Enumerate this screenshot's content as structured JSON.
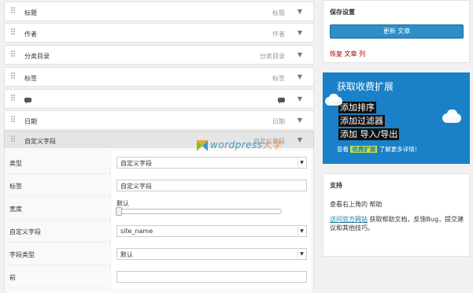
{
  "columns": [
    {
      "name": "标题",
      "desc": "标题"
    },
    {
      "name": "作者",
      "desc": "作者"
    },
    {
      "name": "分类目录",
      "desc": "分类目录"
    },
    {
      "name": "标签",
      "desc": "标签"
    },
    {
      "name": "",
      "desc": "",
      "icon": "comment-icon"
    },
    {
      "name": "日期",
      "desc": "日期"
    },
    {
      "name": "自定义字段",
      "desc": "自定义字段",
      "expanded": true
    }
  ],
  "arrow_glyph": "▼",
  "settings": {
    "type_label": "类型",
    "type_value": "自定义字段",
    "label_label": "标签",
    "label_value": "自定义字段",
    "width_label": "宽度",
    "width_value": "默认",
    "custom_field_label": "自定义字段",
    "custom_field_value": "site_name",
    "field_type_label": "字段类型",
    "field_type_value": "默认",
    "before_label": "前",
    "before_value": ""
  },
  "watermark": {
    "text": "wordpress",
    "cn": "大学"
  },
  "save_box": {
    "title": "保存设置",
    "button": "更新 文章",
    "restore": "恢复 文章 列"
  },
  "promo": {
    "title": "获取收费扩展",
    "features": [
      "添加排序",
      "添加过滤器",
      "添加 导入/导出"
    ],
    "cta_prefix": "查看",
    "cta_highlight": "收费扩展",
    "cta_suffix": "了解更多详情！",
    "bg_color": "#1a80c8"
  },
  "support_box": {
    "title": "支持",
    "line1": "查看右上角的 帮助",
    "link": "访问官方网站",
    "line2": " 获取帮助文档，反馈Bug，提交建议和其他技巧。"
  }
}
